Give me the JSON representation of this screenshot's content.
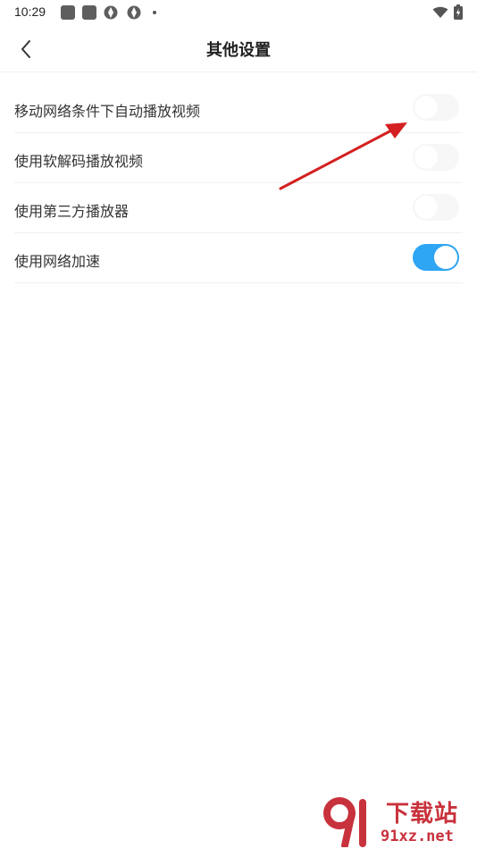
{
  "status_bar": {
    "time": "10:29"
  },
  "header": {
    "title": "其他设置",
    "back_icon": "chevron-left-icon"
  },
  "settings": [
    {
      "label": "移动网络条件下自动播放视频",
      "enabled": false
    },
    {
      "label": "使用软解码播放视频",
      "enabled": false
    },
    {
      "label": "使用第三方播放器",
      "enabled": false
    },
    {
      "label": "使用网络加速",
      "enabled": true
    }
  ],
  "colors": {
    "toggle_on": "#2ea6f4",
    "toggle_off": "#f7f7f7",
    "annotation_arrow": "#d42020"
  },
  "watermark": {
    "text": "下载站",
    "domain": "91xz.net"
  }
}
